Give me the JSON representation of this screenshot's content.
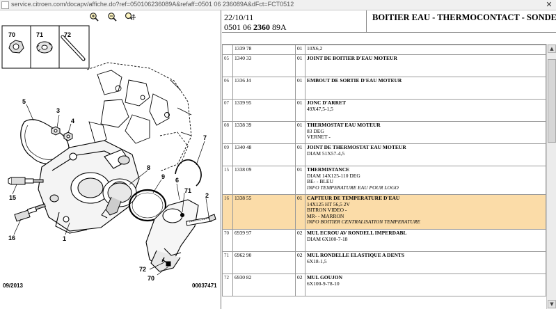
{
  "browser": {
    "url": "service.citroen.com/docapv/affiche.do?ref=050106236089A&refaff=0501 06 236089A&dFct=FCT0512",
    "close_glyph": "✕"
  },
  "diagram": {
    "callouts": [
      "70",
      "71",
      "72",
      "5",
      "3",
      "4",
      "7",
      "8",
      "9",
      "6",
      "71",
      "2",
      "15",
      "16",
      "1",
      "72",
      "70"
    ],
    "footer_left": "09/2013",
    "footer_right": "00037471"
  },
  "toolbar": {
    "icons": [
      "zoom-in-icon",
      "zoom-out-icon",
      "pan-icon"
    ]
  },
  "header": {
    "date": "22/10/11",
    "ref_prefix": "0501 06 ",
    "ref_bold": "2360",
    "ref_suffix": " 89A",
    "title": "BOITIER EAU - THERMOCONTACT - SONDE"
  },
  "rows": [
    {
      "idx": "",
      "ref": "1339 78",
      "qty": "01",
      "title": "",
      "lines": [
        "10X6,2"
      ],
      "italic": "",
      "selected": false,
      "partial": true
    },
    {
      "idx": "05",
      "ref": "1340 33",
      "qty": "01",
      "title": "JOINT DE BOITIER D'EAU MOTEUR",
      "lines": [],
      "italic": "",
      "selected": false
    },
    {
      "idx": "06",
      "ref": "1336 J4",
      "qty": "01",
      "title": "EMBOUT DE SORTIE D'EAU MOTEUR",
      "lines": [],
      "italic": "",
      "selected": false
    },
    {
      "idx": "07",
      "ref": "1339 95",
      "qty": "01",
      "title": "JONC D'ARRET",
      "lines": [
        "49X47,5-1,5"
      ],
      "italic": "",
      "selected": false
    },
    {
      "idx": "08",
      "ref": "1338 39",
      "qty": "01",
      "title": "THERMOSTAT EAU MOTEUR",
      "lines": [
        "83 DEG",
        "VERNET -"
      ],
      "italic": "",
      "selected": false
    },
    {
      "idx": "09",
      "ref": "1340 48",
      "qty": "01",
      "title": "JOINT DE THERMOSTAT EAU MOTEUR",
      "lines": [
        "DIAM 51X57-4,5"
      ],
      "italic": "",
      "selected": false
    },
    {
      "idx": "15",
      "ref": "1338 09",
      "qty": "01",
      "title": "THERMISTANCE",
      "lines": [
        "DIAM 14X125-110 DEG",
        "BE- - BLEU"
      ],
      "italic": "INFO TEMPERATURE EAU POUR LOGO",
      "selected": false
    },
    {
      "idx": "16",
      "ref": "1338 55",
      "qty": "01",
      "title": "CAPTEUR DE TEMPERATURE D'EAU",
      "lines": [
        "14X125 HT 56,5 2V",
        "BITRON VIDEO -",
        "MR- - MARRON"
      ],
      "italic": "INFO BOITIER CENTRALISATION TEMPERATURE",
      "selected": true
    },
    {
      "idx": "70",
      "ref": "6939 97",
      "qty": "02",
      "title": "MUL ECROU AV RONDELL IMPERDABL",
      "lines": [
        "DIAM 6X100-7-18"
      ],
      "italic": "",
      "selected": false
    },
    {
      "idx": "71",
      "ref": "6962 90",
      "qty": "02",
      "title": "MUL RONDELLE ELASTIQUE A DENTS",
      "lines": [
        "6X18-1,5"
      ],
      "italic": "",
      "selected": false
    },
    {
      "idx": "72",
      "ref": "6930 82",
      "qty": "02",
      "title": "MUL GOUJON",
      "lines": [
        "6X100-9-78-10"
      ],
      "italic": "",
      "selected": false
    }
  ],
  "colors": {
    "selected_row": "#fbdca8",
    "grid": "#9a9a9a"
  }
}
